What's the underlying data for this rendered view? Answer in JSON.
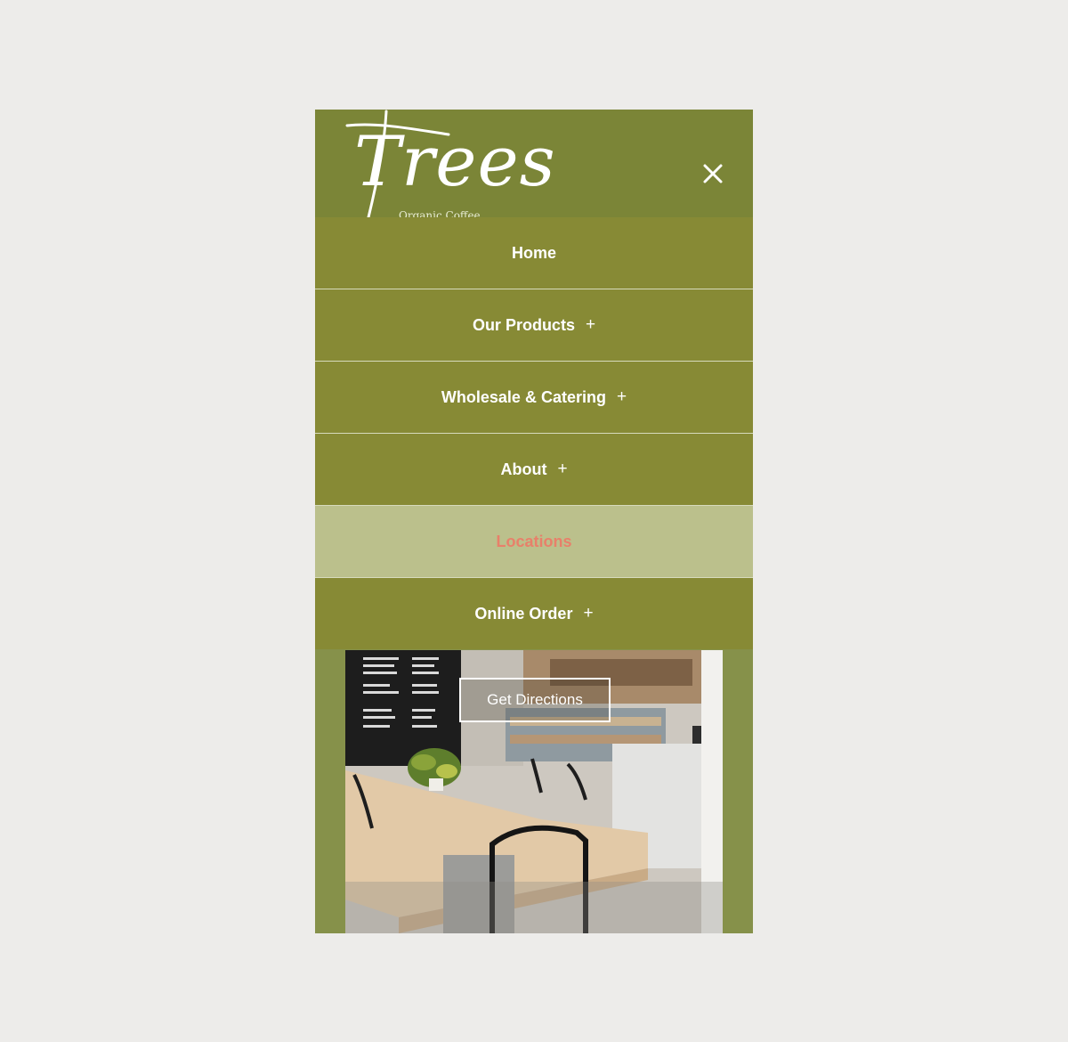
{
  "brand": {
    "logo_text": "Trees",
    "tagline": "Organic Coffee"
  },
  "header": {
    "close_icon": "close-icon",
    "background": "#7b8537"
  },
  "menu": {
    "items": [
      {
        "label": "Home",
        "has_submenu": false,
        "active": false
      },
      {
        "label": "Our Products",
        "has_submenu": true,
        "active": false
      },
      {
        "label": "Wholesale & Catering",
        "has_submenu": true,
        "active": false
      },
      {
        "label": "About",
        "has_submenu": true,
        "active": false
      },
      {
        "label": "Locations",
        "has_submenu": false,
        "active": true
      },
      {
        "label": "Online Order",
        "has_submenu": true,
        "active": false
      }
    ],
    "expand_symbol": "+",
    "item_bg": "#878a35",
    "active_bg": "#bbc08c",
    "active_text": "#e8806a"
  },
  "hero": {
    "image": "cafe-interior-photo",
    "cta_label": "Get Directions"
  }
}
